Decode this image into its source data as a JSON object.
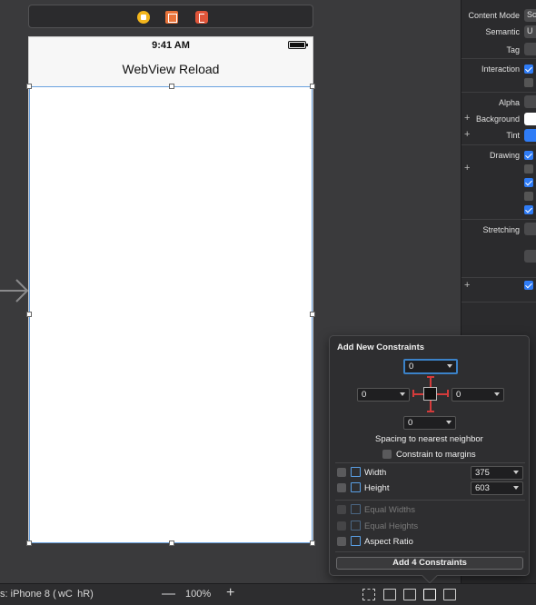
{
  "canvas": {
    "status_time": "9:41 AM",
    "nav_title": "WebView Reload"
  },
  "bottom_bar": {
    "device_label": "iPhone 8 ( wC  hR)",
    "zoom_out": "—",
    "zoom": "100%",
    "zoom_in": "+"
  },
  "inspector": {
    "content_mode_label": "Content Mode",
    "content_mode_value": "Sc",
    "semantic_label": "Semantic",
    "semantic_value": "U",
    "tag_label": "Tag",
    "interaction_label": "Interaction",
    "alpha_label": "Alpha",
    "background_label": "Background",
    "tint_label": "Tint",
    "drawing_label": "Drawing",
    "stretching_label": "Stretching"
  },
  "constraints_popover": {
    "title": "Add New Constraints",
    "top_value": "0",
    "left_value": "0",
    "right_value": "0",
    "bottom_value": "0",
    "spacing_label": "Spacing to nearest neighbor",
    "margins_label": "Constrain to margins",
    "width_label": "Width",
    "width_value": "375",
    "height_label": "Height",
    "height_value": "603",
    "equal_widths_label": "Equal Widths",
    "equal_heights_label": "Equal Heights",
    "aspect_ratio_label": "Aspect Ratio",
    "add_button_label": "Add 4 Constraints"
  },
  "colors": {
    "accent": "#2f7cf6",
    "strut": "#d43b3b",
    "canvas_bg": "#3a3a3c"
  }
}
